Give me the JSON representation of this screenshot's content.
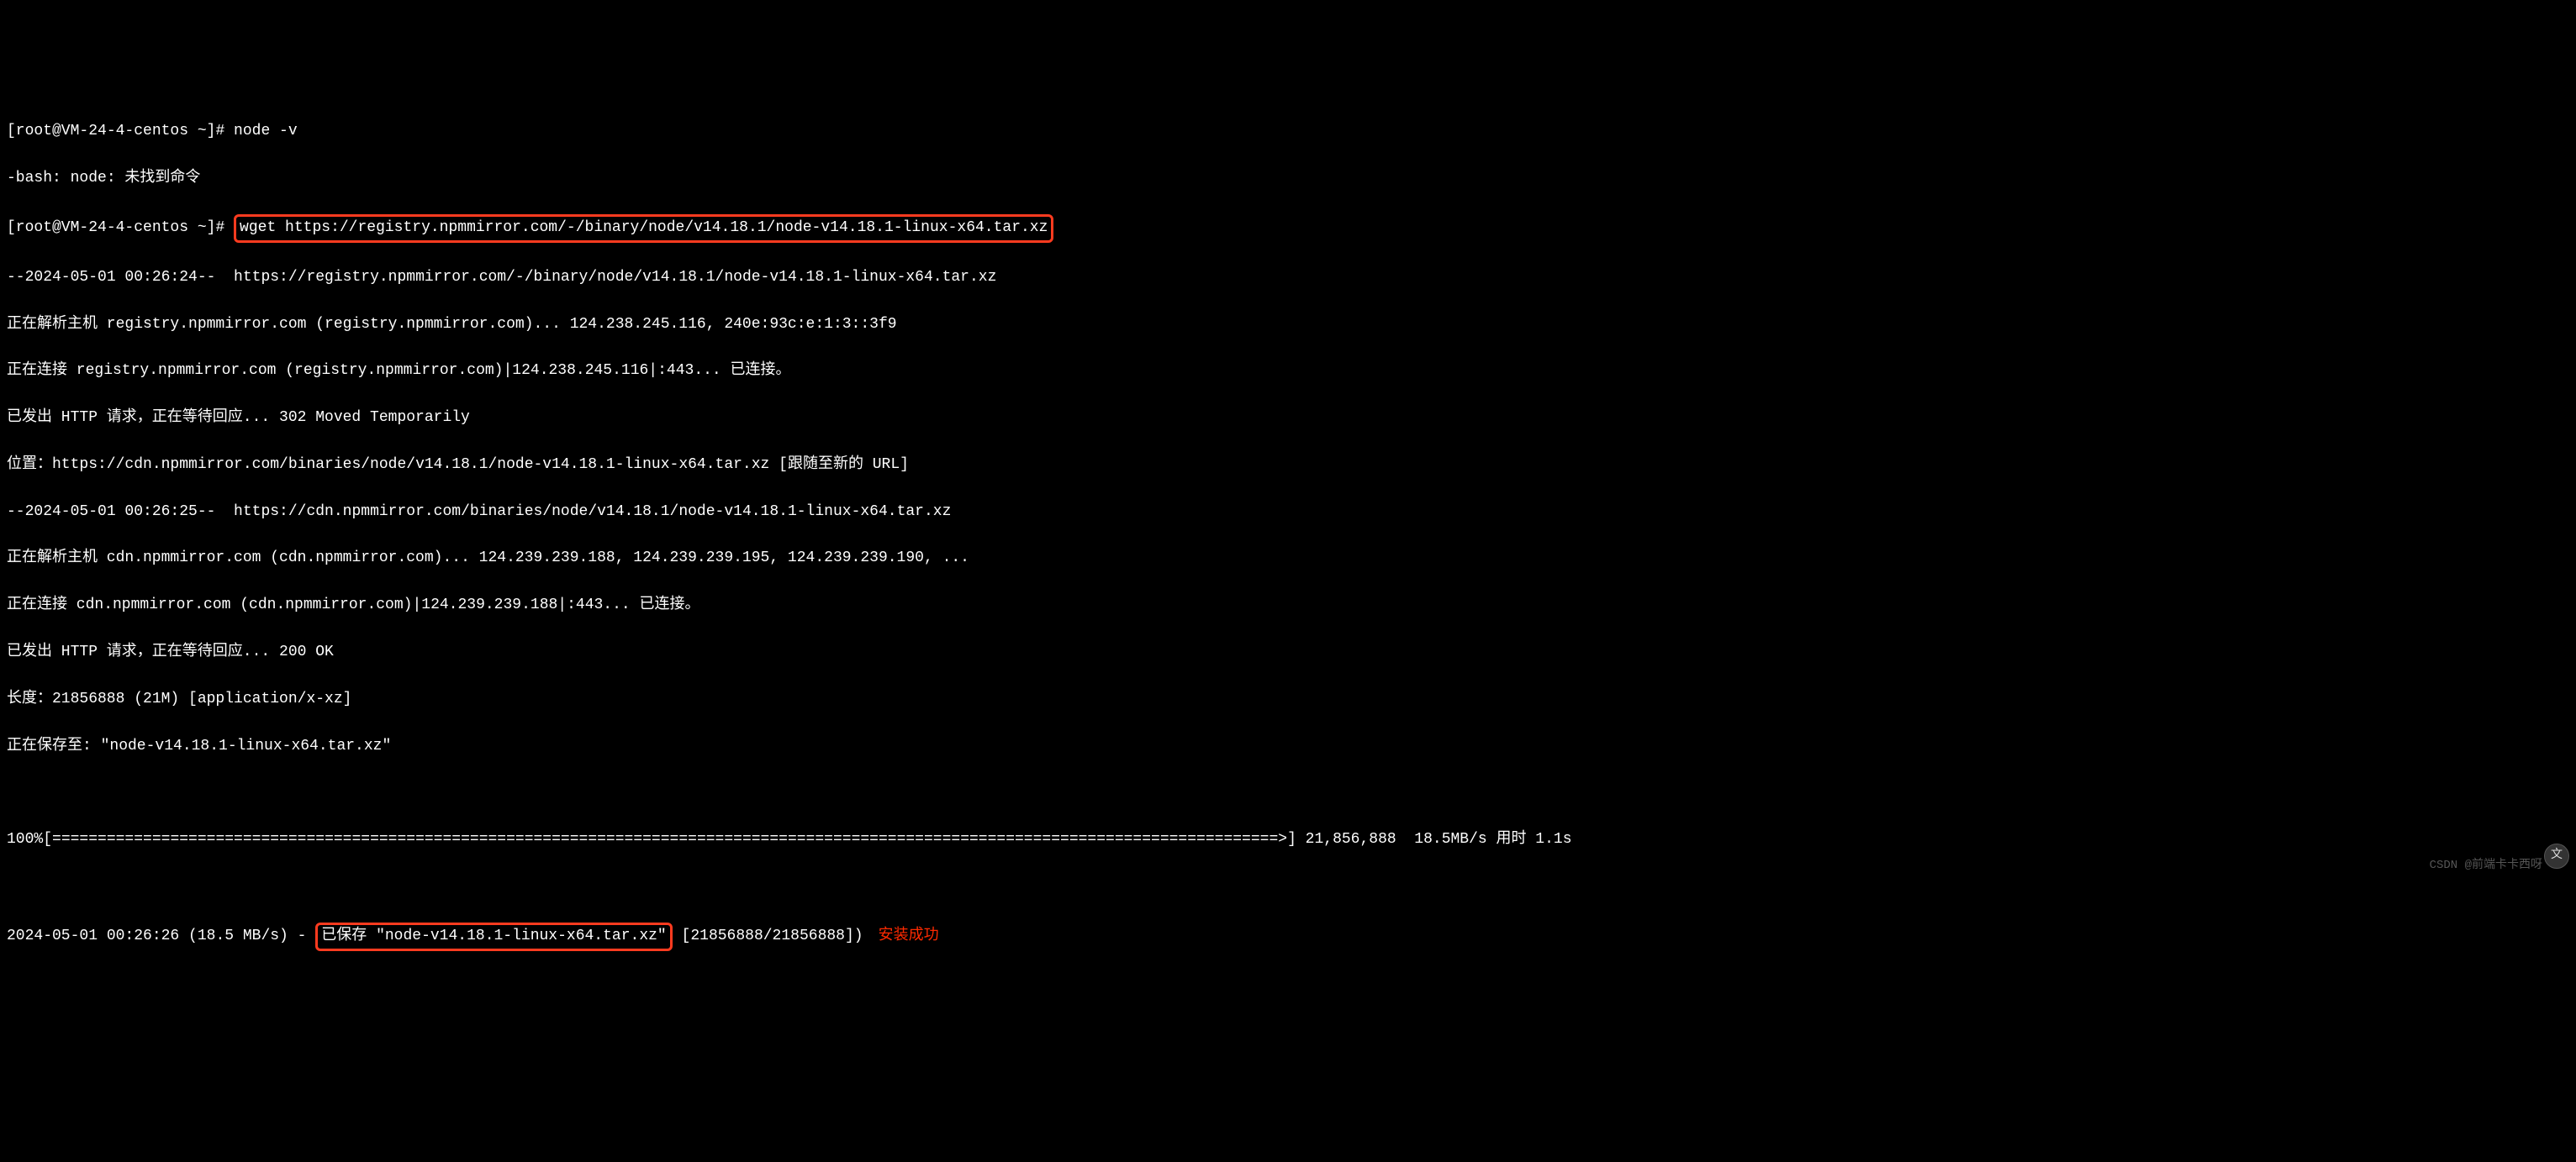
{
  "terminal": {
    "prompt": "[root@VM-24-4-centos ~]# ",
    "cmd1": "node -v",
    "err1": "-bash: node: 未找到命令",
    "cmd2": "wget https://registry.npmmirror.com/-/binary/node/v14.18.1/node-v14.18.1-linux-x64.tar.xz",
    "line3": "--2024-05-01 00:26:24--  https://registry.npmmirror.com/-/binary/node/v14.18.1/node-v14.18.1-linux-x64.tar.xz",
    "line4": "正在解析主机 registry.npmmirror.com (registry.npmmirror.com)... 124.238.245.116, 240e:93c:e:1:3::3f9",
    "line5": "正在连接 registry.npmmirror.com (registry.npmmirror.com)|124.238.245.116|:443... 已连接。",
    "line6": "已发出 HTTP 请求，正在等待回应... 302 Moved Temporarily",
    "line7": "位置：https://cdn.npmmirror.com/binaries/node/v14.18.1/node-v14.18.1-linux-x64.tar.xz [跟随至新的 URL]",
    "line8": "--2024-05-01 00:26:25--  https://cdn.npmmirror.com/binaries/node/v14.18.1/node-v14.18.1-linux-x64.tar.xz",
    "line9": "正在解析主机 cdn.npmmirror.com (cdn.npmmirror.com)... 124.239.239.188, 124.239.239.195, 124.239.239.190, ...",
    "line10": "正在连接 cdn.npmmirror.com (cdn.npmmirror.com)|124.239.239.188|:443... 已连接。",
    "line11": "已发出 HTTP 请求，正在等待回应... 200 OK",
    "line12": "长度：21856888 (21M) [application/x-xz]",
    "line13": "正在保存至: \"node-v14.18.1-linux-x64.tar.xz\"",
    "progress_prefix": "100%[",
    "progress_bar": "=======================================================================================================================================>",
    "progress_suffix": "] 21,856,888  18.5MB/s 用时 1.1s",
    "final_prefix": "2024-05-01 00:26:26 (18.5 MB/s) - ",
    "final_saved": "已保存 \"node-v14.18.1-linux-x64.tar.xz\"",
    "final_suffix": " [21856888/21856888])",
    "annotation": "安装成功"
  },
  "watermark": "CSDN @前端卡卡西呀",
  "icon_label": "文"
}
